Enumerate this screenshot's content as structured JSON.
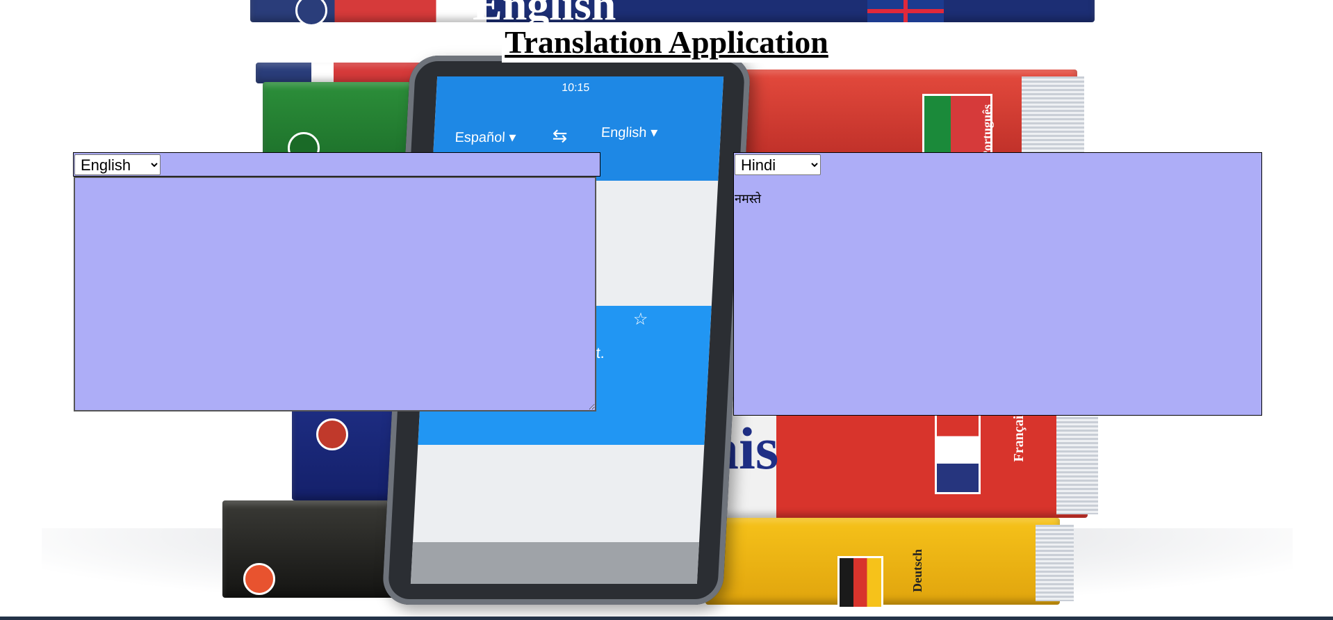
{
  "title": "Translation Application",
  "source": {
    "selected_language": "English",
    "options": [
      "English"
    ],
    "text_value": ""
  },
  "target": {
    "selected_language": "Hindi",
    "options": [
      "Hindi"
    ],
    "output_text": "नमस्ते"
  },
  "background_phone": {
    "status_time": "10:15",
    "lang_from": "Español ▾",
    "lang_to": "English ▾",
    "result_snippet": "ght."
  },
  "background_books": {
    "top_spine_text": "English",
    "french_spine_text": "ais",
    "portuguese_spine_text": "Português",
    "french_side_text": "Français",
    "german_side_text": "Deutsch"
  },
  "colors": {
    "panel_background": "#adadf7",
    "bottom_bar": "#233247"
  }
}
